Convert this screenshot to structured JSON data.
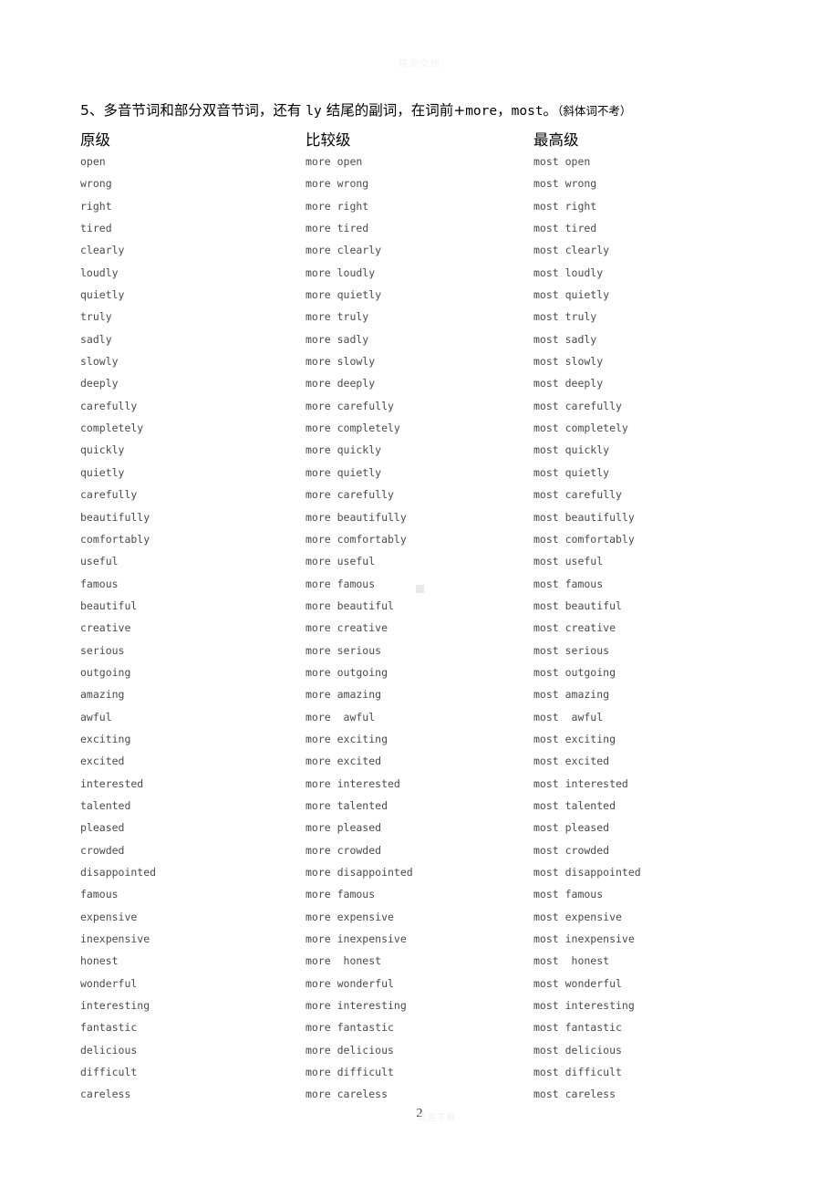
{
  "document": {
    "watermark_top": "精品文档",
    "watermark_bottom": "欢迎下载",
    "page_number": "2"
  },
  "rule": {
    "prefix": "5、多音节词和部分双音节词，还有 ",
    "mono_ly": "ly",
    "middle": " 结尾的副词，在词前+",
    "mono_more": "more",
    "comma": "，",
    "mono_most": "most",
    "period": "。",
    "note": "（斜体词不考）"
  },
  "headers": {
    "positive": "原级",
    "comparative": "比较级",
    "superlative": "最高级"
  },
  "rows": [
    {
      "positive": "open",
      "comparative": "more open",
      "superlative": "most open"
    },
    {
      "positive": "wrong",
      "comparative": "more wrong",
      "superlative": "most wrong"
    },
    {
      "positive": "right",
      "comparative": "more right",
      "superlative": "most right"
    },
    {
      "positive": "tired",
      "comparative": "more tired",
      "superlative": "most tired"
    },
    {
      "positive": "clearly",
      "comparative": "more clearly",
      "superlative": "most clearly"
    },
    {
      "positive": "loudly",
      "comparative": "more loudly",
      "superlative": "most loudly"
    },
    {
      "positive": "quietly",
      "comparative": "more quietly",
      "superlative": "most quietly"
    },
    {
      "positive": "truly",
      "comparative": "more truly",
      "superlative": "most truly"
    },
    {
      "positive": "sadly",
      "comparative": "more sadly",
      "superlative": "most sadly"
    },
    {
      "positive": "slowly",
      "comparative": "more slowly",
      "superlative": "most slowly"
    },
    {
      "positive": "deeply",
      "comparative": "more deeply",
      "superlative": "most deeply"
    },
    {
      "positive": "carefully",
      "comparative": "more carefully",
      "superlative": "most carefully"
    },
    {
      "positive": "completely",
      "comparative": "more completely",
      "superlative": "most completely"
    },
    {
      "positive": "quickly",
      "comparative": "more quickly",
      "superlative": "most quickly"
    },
    {
      "positive": "quietly",
      "comparative": "more quietly",
      "superlative": "most quietly"
    },
    {
      "positive": "carefully",
      "comparative": "more carefully",
      "superlative": "most carefully"
    },
    {
      "positive": "beautifully",
      "comparative": "more beautifully",
      "superlative": "most beautifully"
    },
    {
      "positive": "comfortably",
      "comparative": "more comfortably",
      "superlative": "most comfortably"
    },
    {
      "positive": "useful",
      "comparative": "more useful",
      "superlative": "most useful"
    },
    {
      "positive": "famous",
      "comparative": "more famous",
      "superlative": "most famous"
    },
    {
      "positive": "beautiful",
      "comparative": "more beautiful",
      "superlative": "most beautiful"
    },
    {
      "positive": "creative",
      "comparative": "more creative",
      "superlative": "most creative"
    },
    {
      "positive": "serious",
      "comparative": "more serious",
      "superlative": "most serious"
    },
    {
      "positive": "outgoing",
      "comparative": "more outgoing",
      "superlative": "most outgoing"
    },
    {
      "positive": "amazing",
      "comparative": "more amazing",
      "superlative": "most amazing"
    },
    {
      "positive": "awful",
      "comparative": "more  awful",
      "superlative": "most  awful"
    },
    {
      "positive": "exciting",
      "comparative": "more exciting",
      "superlative": "most exciting"
    },
    {
      "positive": "excited",
      "comparative": "more excited",
      "superlative": "most excited"
    },
    {
      "positive": "interested",
      "comparative": "more interested",
      "superlative": "most interested"
    },
    {
      "positive": "talented",
      "comparative": "more talented",
      "superlative": "most talented"
    },
    {
      "positive": "pleased",
      "comparative": "more pleased",
      "superlative": "most pleased"
    },
    {
      "positive": "crowded",
      "comparative": "more crowded",
      "superlative": "most crowded"
    },
    {
      "positive": "disappointed",
      "comparative": "more disappointed",
      "superlative": "most disappointed"
    },
    {
      "positive": "famous",
      "comparative": "more famous",
      "superlative": "most famous"
    },
    {
      "positive": "expensive",
      "comparative": "more expensive",
      "superlative": "most expensive"
    },
    {
      "positive": "inexpensive",
      "comparative": "more inexpensive",
      "superlative": "most inexpensive"
    },
    {
      "positive": "honest",
      "comparative": "more  honest",
      "superlative": "most  honest"
    },
    {
      "positive": "wonderful",
      "comparative": "more wonderful",
      "superlative": "most wonderful"
    },
    {
      "positive": "interesting",
      "comparative": "more interesting",
      "superlative": "most interesting"
    },
    {
      "positive": "fantastic",
      "comparative": "more fantastic",
      "superlative": "most fantastic"
    },
    {
      "positive": "delicious",
      "comparative": "more delicious",
      "superlative": "most delicious"
    },
    {
      "positive": "difficult",
      "comparative": "more difficult",
      "superlative": "most difficult"
    },
    {
      "positive": "careless",
      "comparative": "more careless",
      "superlative": "most careless"
    }
  ]
}
